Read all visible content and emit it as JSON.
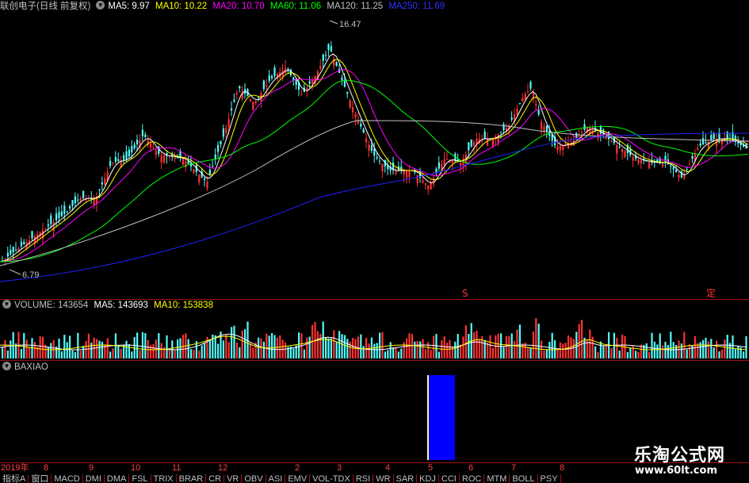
{
  "main_legend": {
    "title": "联创电子(日线 前复权)",
    "items": [
      {
        "label": "MA5: 9.97",
        "color": "#ffffff"
      },
      {
        "label": "MA10: 10.22",
        "color": "#ffff00"
      },
      {
        "label": "MA20: 10.70",
        "color": "#ff00ff"
      },
      {
        "label": "MA60: 11.06",
        "color": "#00ff00"
      },
      {
        "label": "MA120: 11.25",
        "color": "#c0c0c0"
      },
      {
        "label": "MA250: 11.69",
        "color": "#0000ff"
      }
    ]
  },
  "price_marks": {
    "high": "16.47",
    "low": "6.79"
  },
  "signal_marks": {
    "s": "S",
    "ding": "定"
  },
  "volume_legend": {
    "label": "VOLUME: 143654",
    "ma5": "MA5: 143693",
    "ma10": "MA10: 153838",
    "ma5_color": "#ffffff",
    "ma10_color": "#ffff00"
  },
  "indicator_legend": {
    "label": "BAXIAO"
  },
  "time_axis": [
    "2019年",
    "8",
    "9",
    "10",
    "11",
    "12",
    "2",
    "3",
    "4",
    "5",
    "6",
    "7",
    "8"
  ],
  "tabs": [
    "指标A",
    "窗口",
    "MACD",
    "DMI",
    "DMA",
    "FSL",
    "TRIX",
    "BRAR",
    "CR",
    "VR",
    "OBV",
    "ASI",
    "EMV",
    "VOL-TDX",
    "RSI",
    "WR",
    "SAR",
    "KDJ",
    "CCI",
    "ROC",
    "MTM",
    "BOLL",
    "PSY"
  ],
  "watermark": {
    "title": "乐淘公式网",
    "url": "www.60lt.com"
  },
  "colors": {
    "up": "#ff3232",
    "down": "#54fcfc",
    "separator": "#a01010",
    "bar": "#0000ff"
  }
}
